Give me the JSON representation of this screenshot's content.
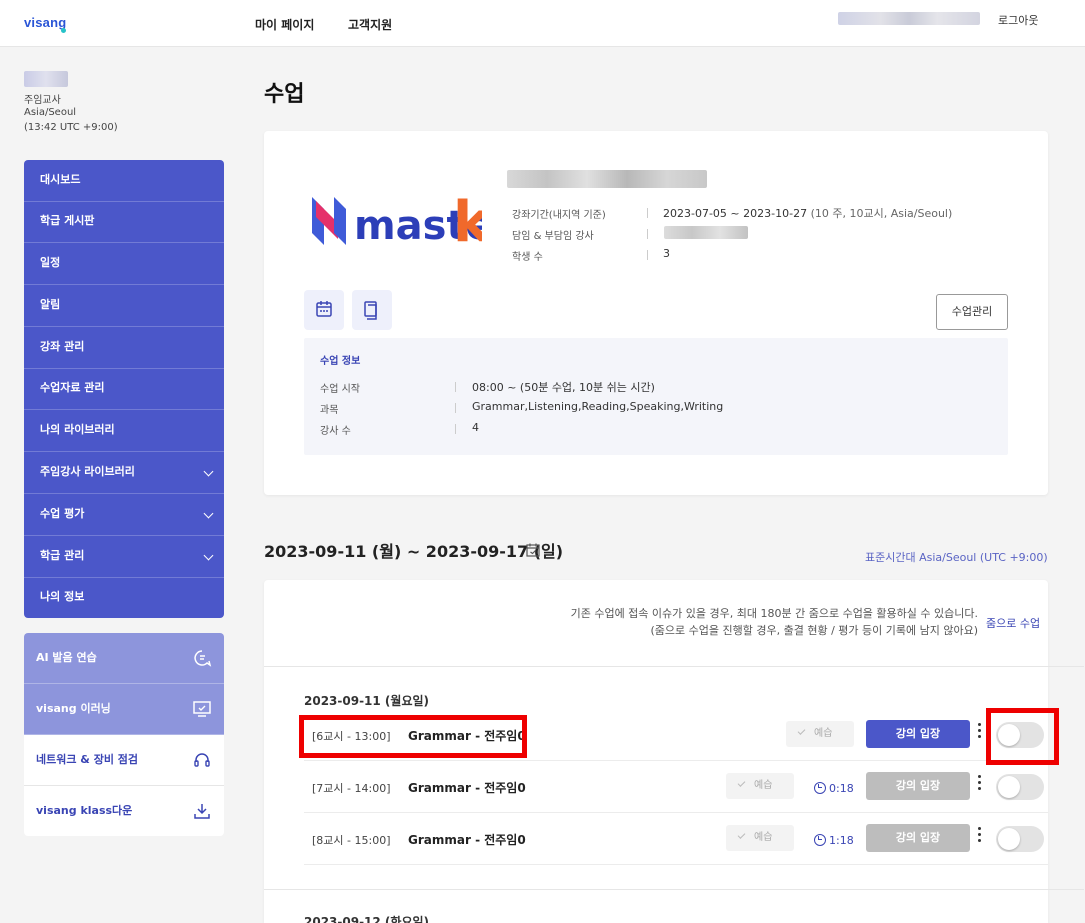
{
  "header": {
    "logo_text": "visang",
    "nav": [
      "마이 페이지",
      "고객지원"
    ],
    "logout": "로그아웃"
  },
  "profile": {
    "role": "주임교사",
    "timezone": "Asia/Seoul",
    "local_time": "(13:42 UTC +9:00)"
  },
  "sidebar": {
    "items": [
      {
        "label": "대시보드",
        "has_chevron": false
      },
      {
        "label": "학급 게시판",
        "has_chevron": false
      },
      {
        "label": "일정",
        "has_chevron": false
      },
      {
        "label": "알림",
        "has_chevron": false
      },
      {
        "label": "강좌 관리",
        "has_chevron": false
      },
      {
        "label": "수업자료 관리",
        "has_chevron": false
      },
      {
        "label": "나의 라이브러리",
        "has_chevron": false
      },
      {
        "label": "주임강사 라이브러리",
        "has_chevron": true
      },
      {
        "label": "수업 평가",
        "has_chevron": true
      },
      {
        "label": "학급 관리",
        "has_chevron": true
      },
      {
        "label": "나의 정보",
        "has_chevron": false
      }
    ],
    "extras": [
      {
        "label": "AI 발음 연습",
        "icon": "speech-icon"
      },
      {
        "label": "visang 이러닝",
        "icon": "monitor-icon"
      },
      {
        "label": "네트워크 & 장비 점검",
        "icon": "headset-icon"
      },
      {
        "label": "visang klass다운",
        "icon": "download-icon"
      }
    ]
  },
  "main": {
    "title": "수업",
    "course": {
      "logo_text_main": "master",
      "logo_text_k": "k",
      "info": [
        {
          "label": "강좌기간(내지역 기준)",
          "value": "2023-07-05 ~ 2023-10-27",
          "sub": "(10 주,  10교시,  Asia/Seoul)"
        },
        {
          "label": "담임 & 부담임 강사",
          "value": "",
          "sub": ""
        },
        {
          "label": "학생 수",
          "value": "3",
          "sub": ""
        }
      ],
      "manage_button": "수업관리",
      "class_info": {
        "title": "수업 정보",
        "rows": [
          {
            "label": "수업 시작",
            "value": "08:00 ~ (50분 수업, 10분 쉬는 시간)"
          },
          {
            "label": "과목",
            "value": "Grammar,Listening,Reading,Speaking,Writing"
          },
          {
            "label": "강사 수",
            "value": "4"
          }
        ]
      }
    },
    "week_range": "2023-09-11 (월) ~ 2023-09-17 (일)",
    "timezone_note": "표준시간대 Asia/Seoul (UTC +9:00)",
    "schedule": {
      "zoom_note_line1": "기존 수업에 접속 이슈가 있을 경우, 최대 180분 간 줌으로 수업을 활용하실 수 있습니다.",
      "zoom_note_line2": "(줌으로 수업을 진행할 경우, 출결 현황 / 평가 등이 기록에 남지 않아요)",
      "zoom_link": "줌으로 수업",
      "day1": "2023-09-11 (월요일)",
      "rows": [
        {
          "period": "[6교시 - 13:00]",
          "subject": "Grammar - 전주임0",
          "review": "예습",
          "timer": "",
          "enter": "강의 입장",
          "enter_active": true,
          "toggle_on": false
        },
        {
          "period": "[7교시 - 14:00]",
          "subject": "Grammar - 전주임0",
          "review": "예습",
          "timer": "0:18",
          "enter": "강의 입장",
          "enter_active": false,
          "toggle_on": false
        },
        {
          "period": "[8교시 - 15:00]",
          "subject": "Grammar - 전주임0",
          "review": "예습",
          "timer": "1:18",
          "enter": "강의 입장",
          "enter_active": false,
          "toggle_on": false
        }
      ],
      "day2": "2023-09-12 (화요일)"
    },
    "colors": {
      "accent": "#4b57c9",
      "highlight": "#ee0000"
    }
  }
}
